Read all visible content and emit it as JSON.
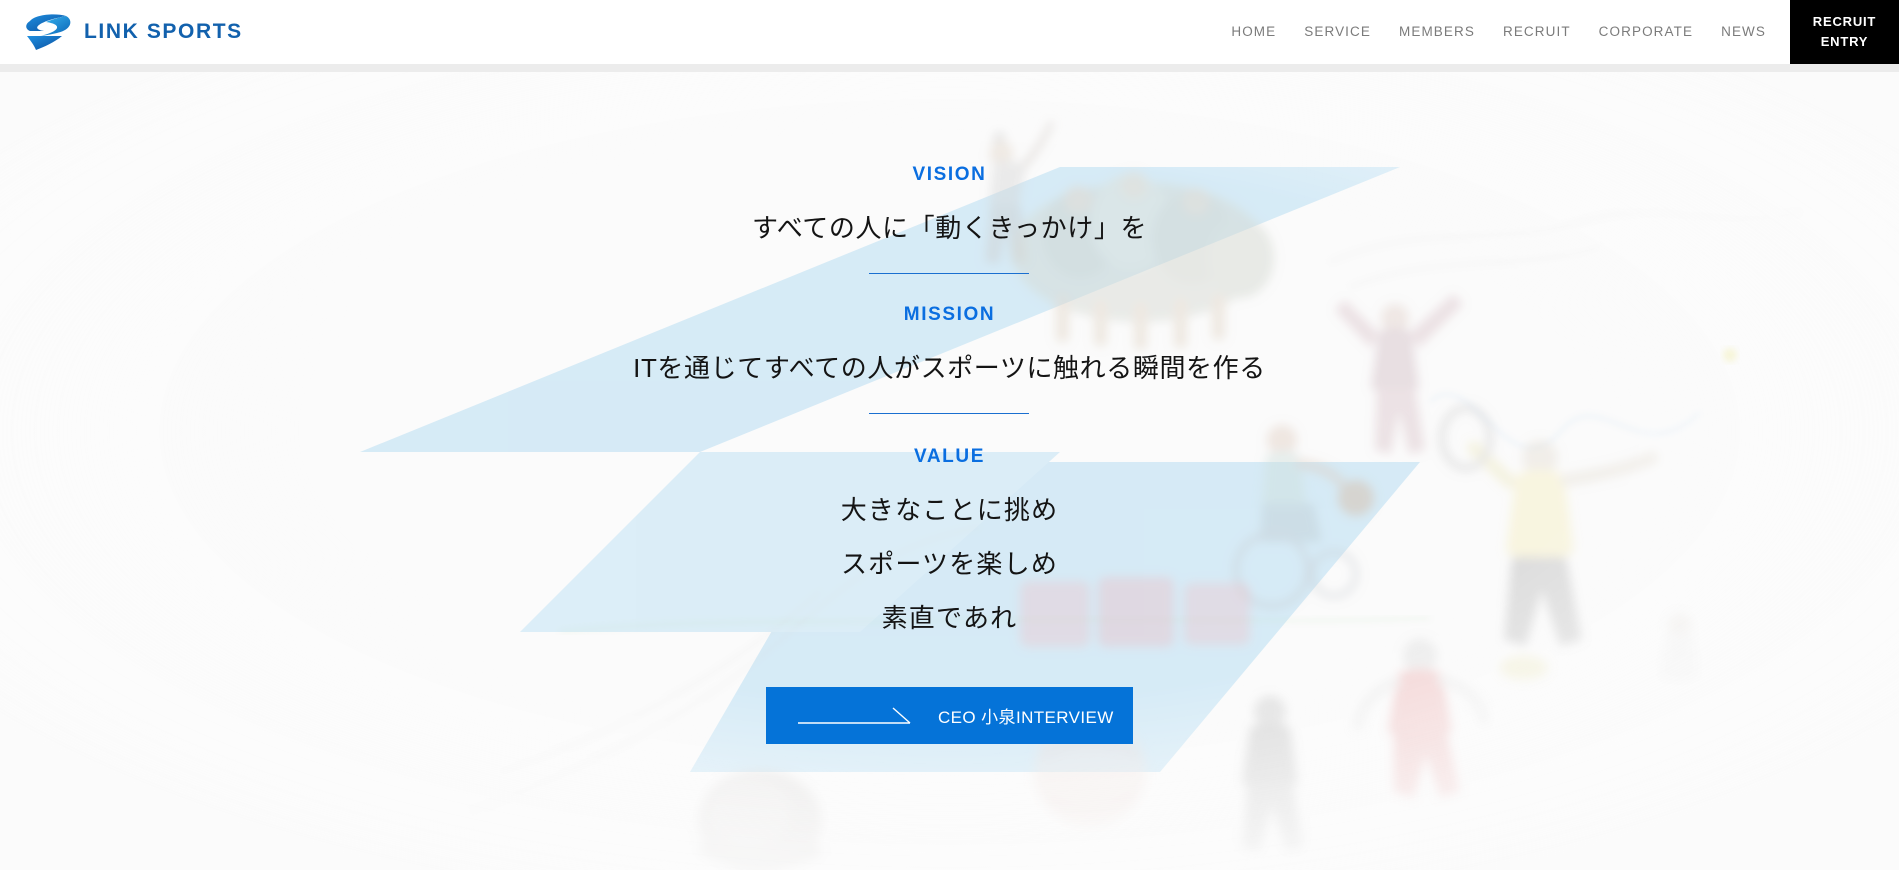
{
  "brand": {
    "name": "LINK SPORTS",
    "logo_icon": "link-sports-swoosh-logo"
  },
  "nav": {
    "items": [
      {
        "label": "HOME"
      },
      {
        "label": "SERVICE"
      },
      {
        "label": "MEMBERS"
      },
      {
        "label": "RECRUIT"
      },
      {
        "label": "CORPORATE"
      },
      {
        "label": "NEWS"
      }
    ],
    "entry_button": {
      "line1": "RECRUIT",
      "line2": "ENTRY"
    }
  },
  "hero": {
    "vision": {
      "label": "VISION",
      "text": "すべての人に「動くきっかけ」を"
    },
    "mission": {
      "label": "MISSION",
      "text": "ITを通じてすべての人がスポーツに触れる瞬間を作る"
    },
    "value": {
      "label": "VALUE",
      "items": [
        "大きなことに挑め",
        "スポーツを楽しめ",
        "素直であれ"
      ]
    },
    "cta": {
      "label": "CEO 小泉INTERVIEW",
      "arrow_icon": "long-arrow-right-icon"
    }
  },
  "colors": {
    "accent_blue": "#0a6ee0",
    "brand_blue": "#1261ad",
    "cta_blue": "#0573d8",
    "divider_blue": "#1a6fd0",
    "entry_black": "#000000",
    "nav_text": "#7b7b7b",
    "page_bg": "#fafafa",
    "bg_shape_blue": "#8ec9ec"
  }
}
